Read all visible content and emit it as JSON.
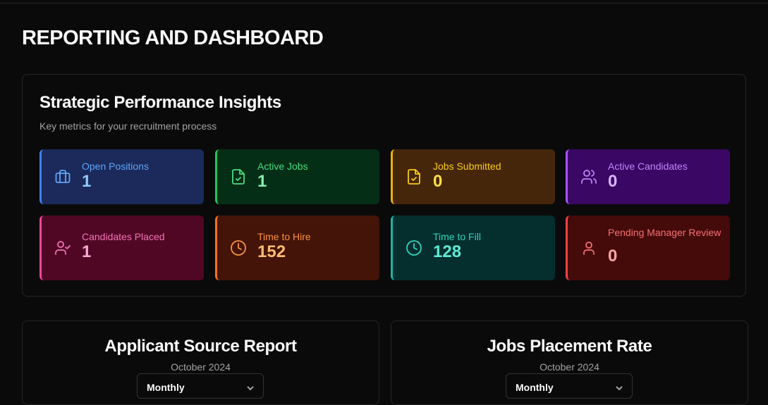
{
  "page": {
    "title": "REPORTING AND DASHBOARD"
  },
  "insights": {
    "title": "Strategic Performance Insights",
    "subtitle": "Key metrics for your recruitment process",
    "metrics": [
      {
        "label": "Open Positions",
        "value": "1",
        "icon": "briefcase-icon",
        "color": "#3b82f6"
      },
      {
        "label": "Active Jobs",
        "value": "1",
        "icon": "file-check-icon",
        "color": "#22c55e"
      },
      {
        "label": "Jobs Submitted",
        "value": "0",
        "icon": "file-check-icon",
        "color": "#eab308"
      },
      {
        "label": "Active Candidates",
        "value": "0",
        "icon": "users-icon",
        "color": "#a855f7"
      },
      {
        "label": "Candidates Placed",
        "value": "1",
        "icon": "user-check-icon",
        "color": "#ec4899"
      },
      {
        "label": "Time to Hire",
        "value": "152",
        "icon": "clock-icon",
        "color": "#f97316"
      },
      {
        "label": "Time to Fill",
        "value": "128",
        "icon": "clock-icon",
        "color": "#14b8a6"
      },
      {
        "label": "Pending Manager Review",
        "value": "0",
        "icon": "user-icon",
        "color": "#ef4444"
      }
    ]
  },
  "applicant_source": {
    "title": "Applicant Source Report",
    "date": "October 2024",
    "period": "Monthly"
  },
  "placement_rate": {
    "title": "Jobs Placement Rate",
    "date": "October 2024",
    "period": "Monthly"
  }
}
